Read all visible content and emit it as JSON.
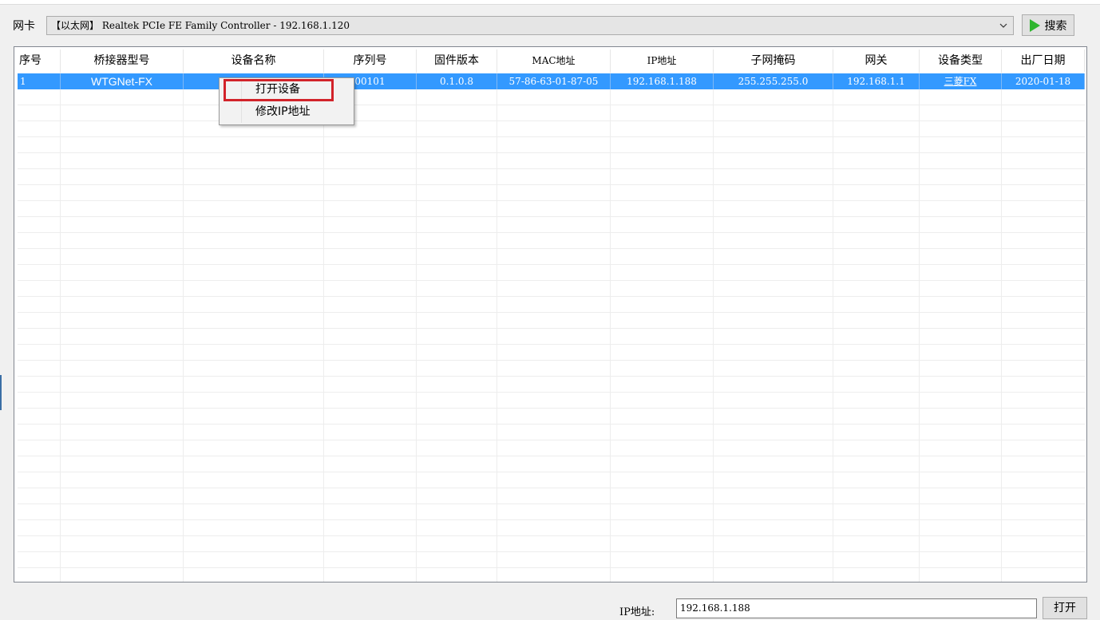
{
  "toolbar": {
    "nic_label": "网卡",
    "nic_selected": "【以太网】 Realtek PCIe FE Family Controller - 192.168.1.120",
    "search_label": "搜索"
  },
  "grid": {
    "columns": [
      "序号",
      "桥接器型号",
      "设备名称",
      "序列号",
      "固件版本",
      "MAC地址",
      "IP地址",
      "子网掩码",
      "网关",
      "设备类型",
      "出厂日期"
    ],
    "rows": [
      {
        "index": "1",
        "bridge_model": "WTGNet-FX",
        "device_name": "",
        "serial": "00101",
        "firmware": "0.1.0.8",
        "mac": "57-86-63-01-87-05",
        "ip": "192.168.1.188",
        "subnet": "255.255.255.0",
        "gateway": "192.168.1.1",
        "device_type": "三菱FX",
        "factory_date": "2020-01-18"
      }
    ]
  },
  "context_menu": {
    "open_device": "打开设备",
    "modify_ip": "修改IP地址"
  },
  "bottom": {
    "ip_label": "IP地址:",
    "ip_value": "192.168.1.188",
    "open_label": "打开"
  },
  "colors": {
    "selection": "#3399ff",
    "highlight_box": "#d2232a",
    "play_icon": "#2fb52f"
  },
  "icons": [
    "chevron-down-icon",
    "play-icon"
  ]
}
